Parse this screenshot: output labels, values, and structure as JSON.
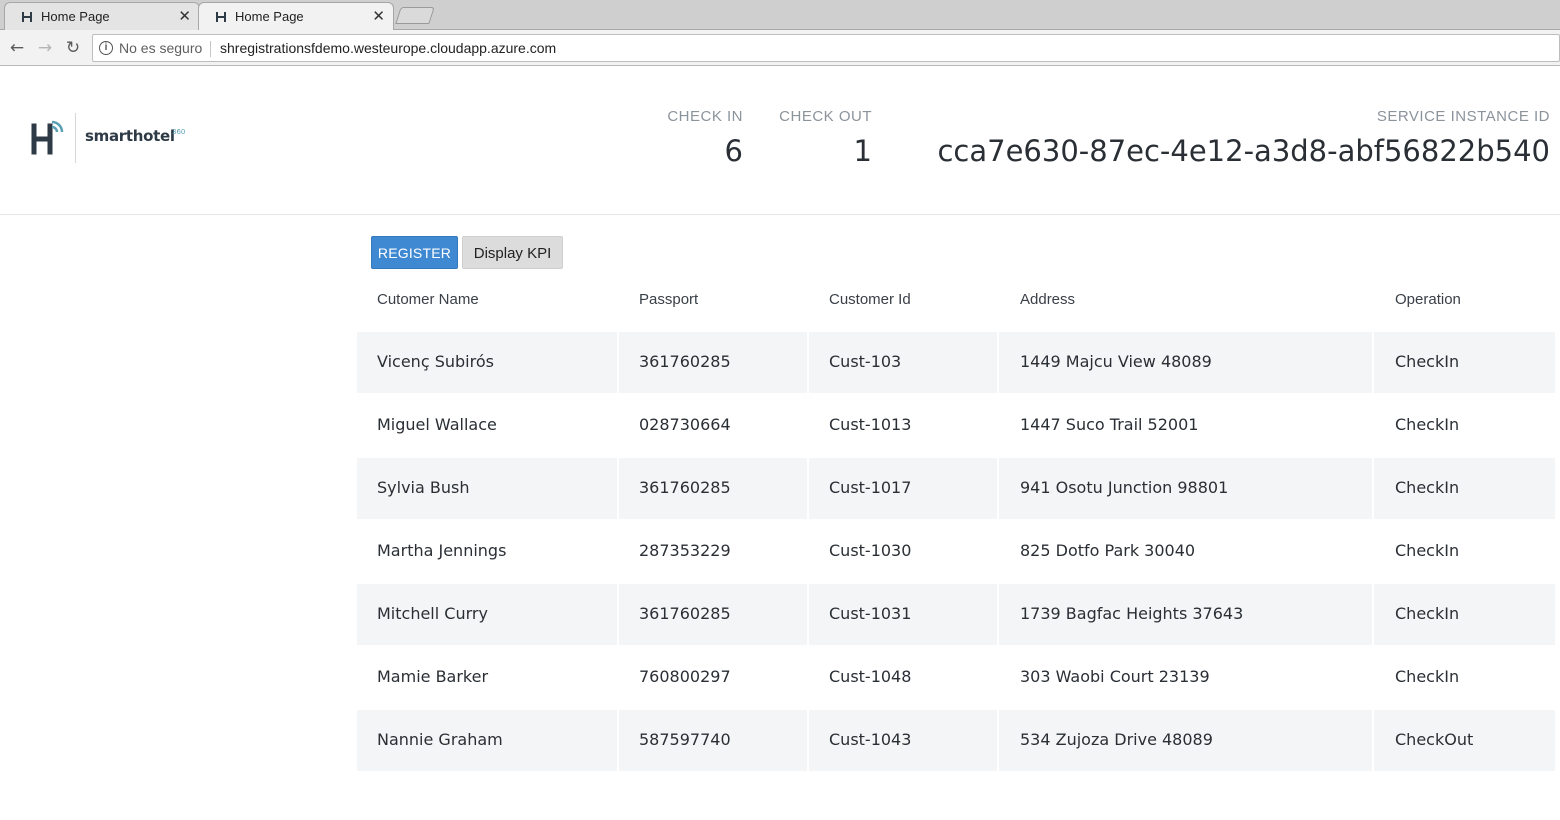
{
  "browser": {
    "tabs": [
      {
        "label": "Home Page"
      },
      {
        "label": "Home Page"
      }
    ],
    "close_glyph": "✕",
    "nav": {
      "back": "←",
      "forward": "→",
      "reload": "↻"
    },
    "address": {
      "security_label": "No es seguro",
      "url": "shregistrationsfdemo.westeurope.cloudapp.azure.com"
    }
  },
  "brand": {
    "name": "smarthotel",
    "superscript": "360",
    "accent_color": "#5aa0b5",
    "dark_color": "#2e3a46"
  },
  "kpis": {
    "checkin": {
      "label": "CHECK IN",
      "value": "6"
    },
    "checkout": {
      "label": "CHECK OUT",
      "value": "1"
    },
    "service": {
      "label": "SERVICE INSTANCE ID",
      "value": "cca7e630-87ec-4e12-a3d8-abf56822b540"
    }
  },
  "actions": {
    "register_label": "REGISTER",
    "kpi_label": "Display KPI",
    "register_color": "#3f88d2"
  },
  "table": {
    "headers": {
      "name": "Cutomer Name",
      "passport": "Passport",
      "customer_id": "Customer Id",
      "address": "Address",
      "operation": "Operation"
    },
    "rows": [
      {
        "name": "Vicenç Subirós",
        "passport": "361760285",
        "customer_id": "Cust-103",
        "address": "1449 Majcu View 48089",
        "operation": "CheckIn"
      },
      {
        "name": "Miguel Wallace",
        "passport": "028730664",
        "customer_id": "Cust-1013",
        "address": "1447 Suco Trail 52001",
        "operation": "CheckIn"
      },
      {
        "name": "Sylvia Bush",
        "passport": "361760285",
        "customer_id": "Cust-1017",
        "address": "941 Osotu Junction 98801",
        "operation": "CheckIn"
      },
      {
        "name": "Martha Jennings",
        "passport": "287353229",
        "customer_id": "Cust-1030",
        "address": "825 Dotfo Park 30040",
        "operation": "CheckIn"
      },
      {
        "name": "Mitchell Curry",
        "passport": "361760285",
        "customer_id": "Cust-1031",
        "address": "1739 Bagfac Heights 37643",
        "operation": "CheckIn"
      },
      {
        "name": "Mamie Barker",
        "passport": "760800297",
        "customer_id": "Cust-1048",
        "address": "303 Waobi Court 23139",
        "operation": "CheckIn"
      },
      {
        "name": "Nannie Graham",
        "passport": "587597740",
        "customer_id": "Cust-1043",
        "address": "534 Zujoza Drive 48089",
        "operation": "CheckOut"
      }
    ]
  }
}
